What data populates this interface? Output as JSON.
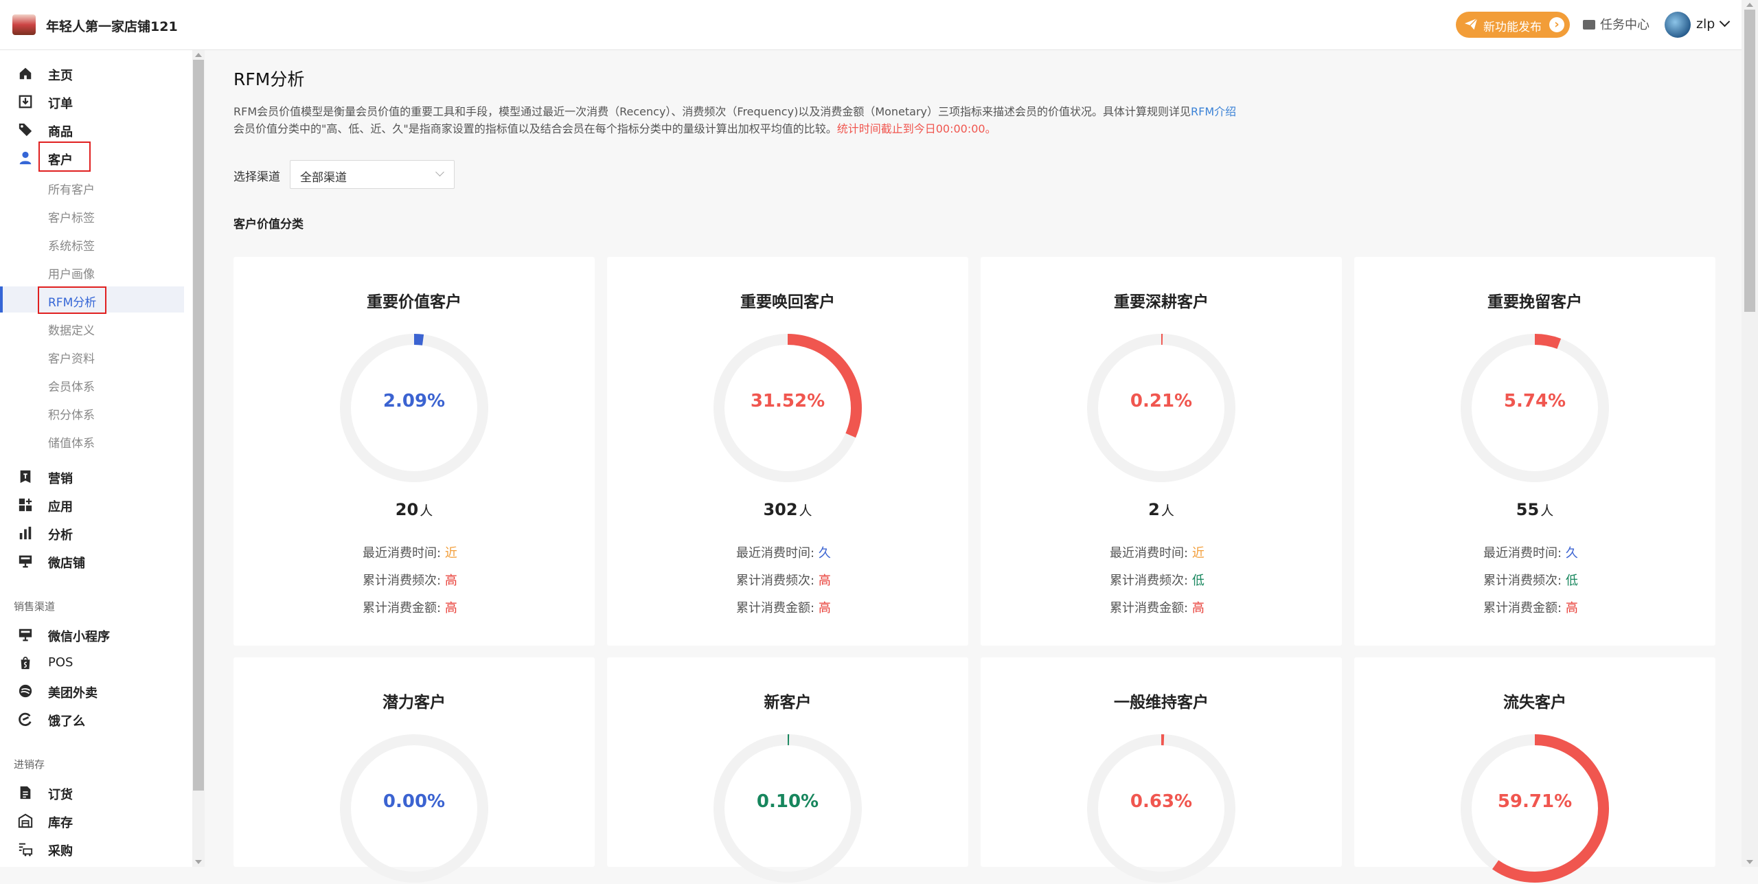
{
  "header": {
    "shop_name": "年轻人第一家店铺121",
    "new_feature": "新功能发布",
    "task_center": "任务中心",
    "username": "zlp"
  },
  "sidebar": {
    "main_items": [
      {
        "label": "主页",
        "icon": "home-icon"
      },
      {
        "label": "订单",
        "icon": "order-icon"
      },
      {
        "label": "商品",
        "icon": "tag-icon"
      },
      {
        "label": "客户",
        "icon": "user-icon"
      }
    ],
    "customer_sub": [
      "所有客户",
      "客户标签",
      "系统标签",
      "用户画像",
      "RFM分析",
      "数据定义",
      "客户资料",
      "会员体系",
      "积分体系",
      "储值体系"
    ],
    "more_items": [
      {
        "label": "营销",
        "icon": "marketing-icon"
      },
      {
        "label": "应用",
        "icon": "apps-icon"
      },
      {
        "label": "分析",
        "icon": "chart-icon"
      },
      {
        "label": "微店铺",
        "icon": "store-icon"
      }
    ],
    "section_sales": "销售渠道",
    "sales_items": [
      {
        "label": "微信小程序",
        "icon": "miniprogram-icon"
      },
      {
        "label": "POS",
        "icon": "pos-icon"
      },
      {
        "label": "美团外卖",
        "icon": "meituan-icon"
      },
      {
        "label": "饿了么",
        "icon": "eleme-icon"
      }
    ],
    "section_inventory": "进销存",
    "inventory_items": [
      {
        "label": "订货",
        "icon": "document-icon"
      },
      {
        "label": "库存",
        "icon": "warehouse-icon"
      },
      {
        "label": "采购",
        "icon": "purchase-icon"
      }
    ]
  },
  "page": {
    "title": "RFM分析",
    "desc1": "RFM会员价值模型是衡量会员价值的重要工具和手段，模型通过最近一次消费（Recency）、消费频次（Frequency)以及消费金额（Monetary）三项指标来描述会员的价值状况。具体计算规则详见",
    "desc1_link": "RFM介绍",
    "desc2": "会员价值分类中的\"高、低、近、久\"是指商家设置的指标值以及结合会员在每个指标分类中的量级计算出加权平均值的比较。",
    "desc2_red": "统计时间截止到今日00:00:00。",
    "channel_label": "选择渠道",
    "channel_value": "全部渠道",
    "section_title": "客户价值分类"
  },
  "attr_labels": {
    "recency": "最近消费时间:",
    "frequency": "累计消费频次:",
    "monetary": "累计消费金额:"
  },
  "count_unit": "人",
  "cards": [
    {
      "title": "重要价值客户",
      "percent": "2.09%",
      "fraction": 0.0209,
      "color": "#3b63d1",
      "count": "20",
      "recency": "近",
      "frequency": "高",
      "monetary": "高"
    },
    {
      "title": "重要唤回客户",
      "percent": "31.52%",
      "fraction": 0.3152,
      "color": "#f0564f",
      "count": "302",
      "recency": "久",
      "frequency": "高",
      "monetary": "高"
    },
    {
      "title": "重要深耕客户",
      "percent": "0.21%",
      "fraction": 0.0021,
      "color": "#f0564f",
      "count": "2",
      "recency": "近",
      "frequency": "低",
      "monetary": "高"
    },
    {
      "title": "重要挽留客户",
      "percent": "5.74%",
      "fraction": 0.0574,
      "color": "#f0564f",
      "count": "55",
      "recency": "久",
      "frequency": "低",
      "monetary": "高"
    },
    {
      "title": "潜力客户",
      "percent": "0.00%",
      "fraction": 0.0,
      "color": "#3b63d1"
    },
    {
      "title": "新客户",
      "percent": "0.10%",
      "fraction": 0.001,
      "color": "#17865d"
    },
    {
      "title": "一般维持客户",
      "percent": "0.63%",
      "fraction": 0.0063,
      "color": "#f0564f"
    },
    {
      "title": "流失客户",
      "percent": "59.71%",
      "fraction": 0.5971,
      "color": "#f0564f"
    }
  ],
  "value_colors": {
    "近": "#f29d38",
    "久": "#3b63d1",
    "高": "#e8403a",
    "低": "#17865d"
  }
}
